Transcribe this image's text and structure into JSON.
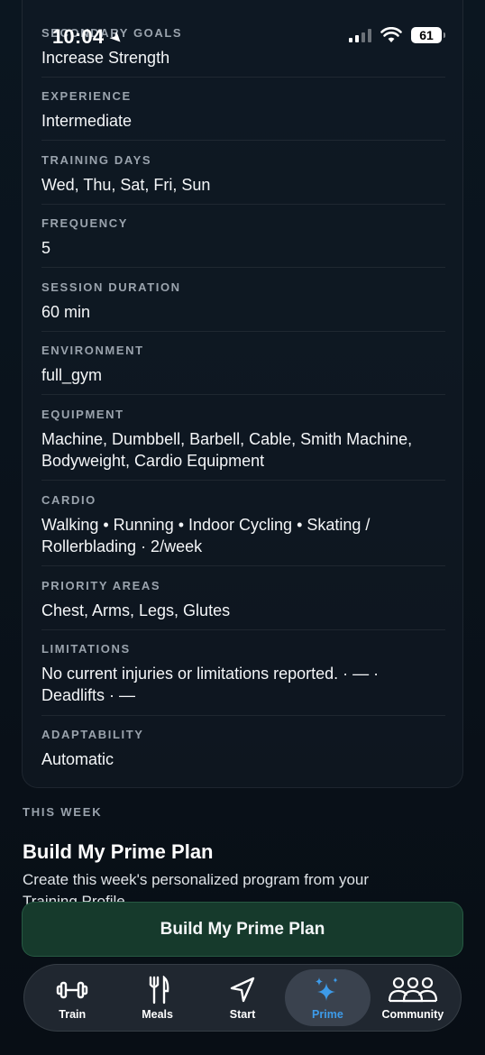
{
  "status": {
    "time": "10:04",
    "battery": "61"
  },
  "profile": {
    "fields": [
      {
        "label": "SECONDARY GOALS",
        "value": "Increase Strength"
      },
      {
        "label": "EXPERIENCE",
        "value": "Intermediate"
      },
      {
        "label": "TRAINING DAYS",
        "value": "Wed, Thu, Sat, Fri, Sun"
      },
      {
        "label": "FREQUENCY",
        "value": "5"
      },
      {
        "label": "SESSION DURATION",
        "value": "60 min"
      },
      {
        "label": "ENVIRONMENT",
        "value": "full_gym"
      },
      {
        "label": "EQUIPMENT",
        "value": "Machine, Dumbbell, Barbell, Cable, Smith Machine, Bodyweight, Cardio Equipment"
      },
      {
        "label": "CARDIO",
        "value": "Walking • Running • Indoor Cycling • Skating / Rollerblading · 2/week"
      },
      {
        "label": "PRIORITY AREAS",
        "value": "Chest, Arms, Legs, Glutes"
      },
      {
        "label": "LIMITATIONS",
        "value": "No current injuries or limitations reported. · — · Deadlifts · —"
      },
      {
        "label": "ADAPTABILITY",
        "value": "Automatic"
      }
    ]
  },
  "week": {
    "label": "THIS WEEK",
    "title": "Build My Prime Plan",
    "description": "Create this week's personalized program from your Training Profile.",
    "button_label": "Build My Prime Plan"
  },
  "tabs": [
    {
      "label": "Train",
      "icon": "dumbbell-icon",
      "active": false
    },
    {
      "label": "Meals",
      "icon": "fork-knife-icon",
      "active": false
    },
    {
      "label": "Start",
      "icon": "location-arrow-icon",
      "active": false
    },
    {
      "label": "Prime",
      "icon": "sparkles-icon",
      "active": true
    },
    {
      "label": "Community",
      "icon": "people-icon",
      "active": false
    }
  ],
  "colors": {
    "accent": "#3d9be9",
    "button_bg": "#163a2c",
    "background": "#0a131c"
  }
}
